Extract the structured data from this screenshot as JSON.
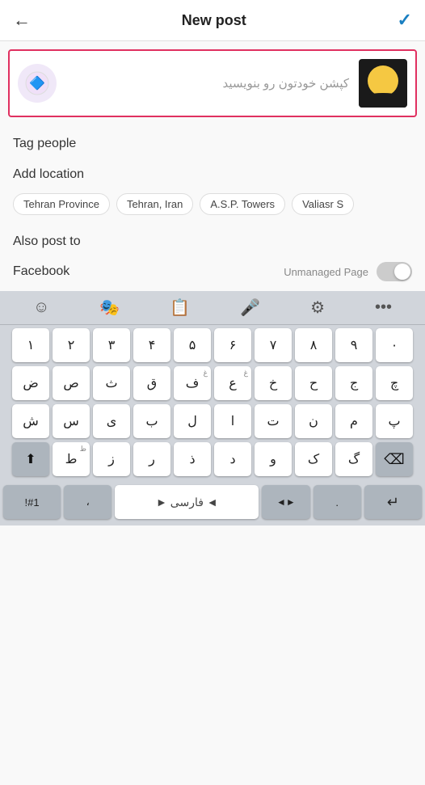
{
  "header": {
    "back_icon": "←",
    "title": "New post",
    "check_icon": "✓"
  },
  "post": {
    "avatar_icon": "🔷",
    "caption_placeholder": "کپشن خودتون رو بنویسید"
  },
  "tag_people": {
    "label": "Tag people"
  },
  "add_location": {
    "label": "Add location",
    "tags": [
      "Tehran Province",
      "Tehran, Iran",
      "A.S.P. Towers",
      "Valiasr S"
    ]
  },
  "also_post": {
    "label": "Also post to",
    "facebook": {
      "label": "Facebook",
      "unmanaged": "Unmanaged Page"
    }
  },
  "keyboard": {
    "toolbar": {
      "emoji": "☺",
      "sticker": "🎭",
      "clipboard": "📋",
      "mic": "🎤",
      "settings": "⚙",
      "more": "···"
    },
    "rows": [
      [
        "۱",
        "۲",
        "۳",
        "۴",
        "۵",
        "۶",
        "۷",
        "۸",
        "۹",
        "۰"
      ],
      [
        "ض",
        "ص",
        "ث",
        "ق",
        "ف",
        "غ",
        "ع",
        "خ",
        "ح",
        "ج",
        "چ"
      ],
      [
        "ش",
        "س",
        "ی",
        "ب",
        "ل",
        "ا",
        "ت",
        "ن",
        "م",
        "پ"
      ],
      [
        "shift",
        "ط",
        "ظ",
        "ز",
        "ر",
        "ذ",
        "د",
        "و",
        "ک",
        "گ",
        "⌫"
      ]
    ],
    "bottom": {
      "special_left": "!#1",
      "comma": "،",
      "space": "◄ فارسی ►",
      "period": "◄►",
      "dot": ".",
      "return": "↵"
    }
  }
}
